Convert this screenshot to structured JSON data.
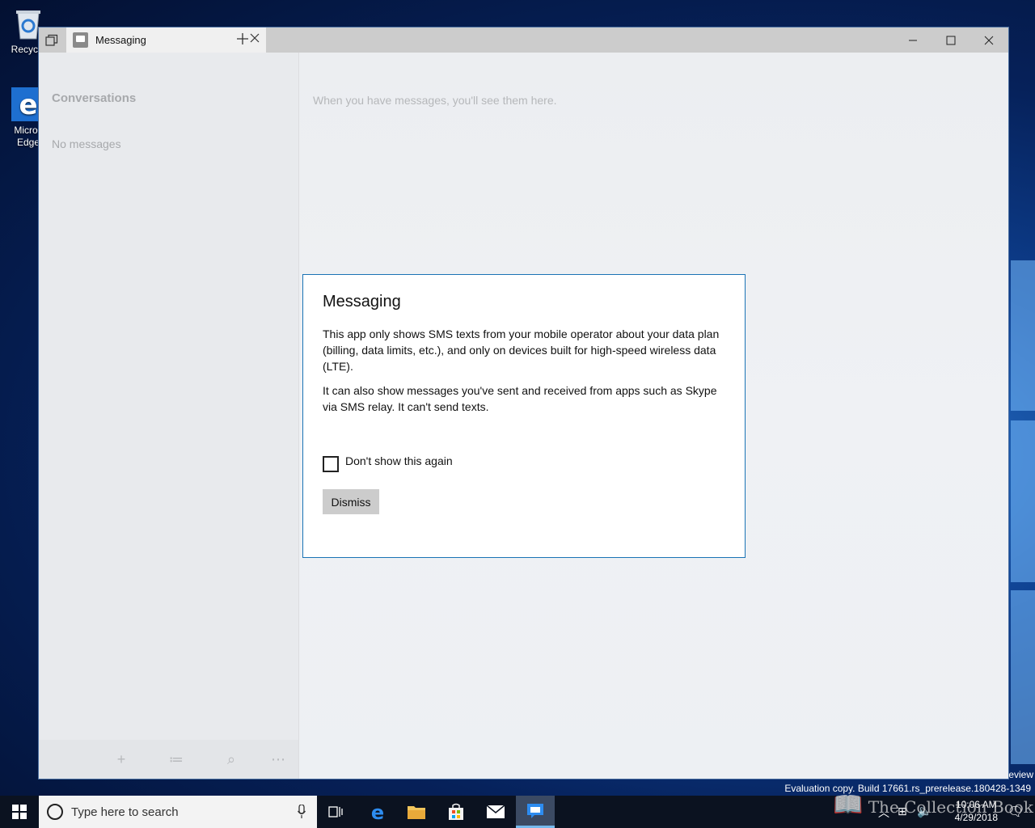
{
  "desktop": {
    "icons": [
      {
        "label": "Recycle",
        "icon": "recycle-bin-icon"
      },
      {
        "label": "Micros\nEdge",
        "icon": "edge-icon"
      }
    ],
    "eval_line1": "eview",
    "eval_line2": "Evaluation copy. Build 17661.rs_prerelease.180428-1349"
  },
  "window": {
    "tab_title": "Messaging",
    "icons": {
      "tab_switcher": "tab-switcher-icon",
      "tab_close": "close-icon",
      "new_tab": "plus-icon",
      "minimize": "minimize-icon",
      "maximize": "maximize-icon",
      "close": "close-icon"
    }
  },
  "left_pane": {
    "heading": "Conversations",
    "empty_text": "No messages",
    "toolbar": [
      {
        "name": "new-message-button",
        "glyph": "+",
        "icon": "plus-icon"
      },
      {
        "name": "select-button",
        "glyph": "≔",
        "icon": "select-list-icon"
      },
      {
        "name": "search-button",
        "glyph": "⌕",
        "icon": "search-icon"
      },
      {
        "name": "more-button",
        "glyph": "⋯",
        "icon": "more-icon"
      }
    ]
  },
  "right_pane": {
    "empty_text": "When you have messages, you'll see them here."
  },
  "dialog": {
    "title": "Messaging",
    "paragraph1": "This app only shows SMS texts from your mobile operator about your data plan (billing, data limits, etc.), and only on devices built for high-speed wireless data (LTE).",
    "paragraph2": "It can also show messages you've sent and received from apps such as Skype via SMS relay. It can't send texts.",
    "checkbox_label": "Don't show this again",
    "checkbox_checked": false,
    "dismiss_label": "Dismiss"
  },
  "taskbar": {
    "search_placeholder": "Type here to search",
    "apps": [
      "task-view-icon",
      "edge-icon",
      "file-explorer-icon",
      "store-icon",
      "mail-icon",
      "messaging-icon"
    ],
    "active_app": "messaging-icon",
    "clock_time": "10:06 AM",
    "clock_date": "4/29/2018",
    "watermark": "The Collection Book"
  },
  "colors": {
    "accent": "#1a73b5",
    "titlebar": "#cccccc",
    "taskbar": "#0b1220"
  }
}
